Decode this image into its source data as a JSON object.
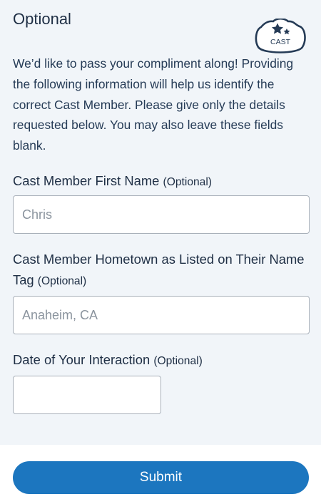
{
  "section": {
    "title": "Optional",
    "badge_text": "CAST",
    "intro": "We’d like to pass your compliment along! Providing the following information will help us identify the correct Cast Member. Please give only the details requested below. You may also leave these fields blank."
  },
  "fields": {
    "first_name": {
      "label": "Cast Member First Name",
      "optional_tag": "(Optional)",
      "placeholder": "Chris",
      "value": ""
    },
    "hometown": {
      "label": "Cast Member Hometown as Listed on Their Name Tag",
      "optional_tag": "(Optional)",
      "placeholder": "Anaheim, CA",
      "value": ""
    },
    "interaction_date": {
      "label": "Date of Your Interaction",
      "optional_tag": "(Optional)",
      "placeholder": "",
      "value": ""
    }
  },
  "actions": {
    "submit_label": "Submit"
  },
  "colors": {
    "panel_background": "#f1f5f9",
    "text": "#253b56",
    "submit_button": "#1c76bf",
    "field_border": "#a9b1ba"
  }
}
